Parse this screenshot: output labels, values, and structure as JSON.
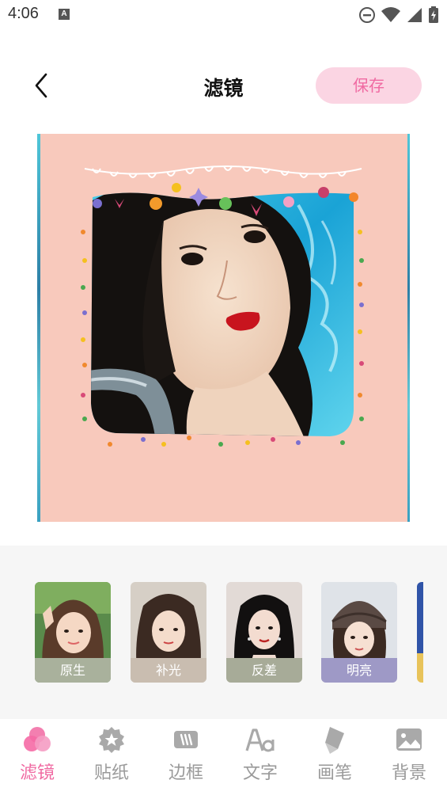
{
  "status_bar": {
    "time": "4:06",
    "notification_letter": "A"
  },
  "header": {
    "title": "滤镜",
    "save_label": "保存"
  },
  "filters": [
    {
      "label": "原生",
      "label_color": "#a9b19c"
    },
    {
      "label": "补光",
      "label_color": "#c9bdb0"
    },
    {
      "label": "反差",
      "label_color": "#a7ab98"
    },
    {
      "label": "明亮",
      "label_color": "#9e99c6"
    }
  ],
  "bottom_nav": {
    "items": [
      {
        "label": "滤镜",
        "icon": "filter-icon",
        "active": true
      },
      {
        "label": "贴纸",
        "icon": "sticker-icon",
        "active": false
      },
      {
        "label": "边框",
        "icon": "frame-icon",
        "active": false
      },
      {
        "label": "文字",
        "icon": "text-icon",
        "active": false
      },
      {
        "label": "画笔",
        "icon": "brush-icon",
        "active": false
      },
      {
        "label": "背景",
        "icon": "background-icon",
        "active": false
      }
    ]
  },
  "colors": {
    "accent_pink": "#f06aa2",
    "save_bg": "#fbd5e3",
    "canvas_bg": "#f8c9bc",
    "inactive_gray": "#9a9a9a"
  }
}
